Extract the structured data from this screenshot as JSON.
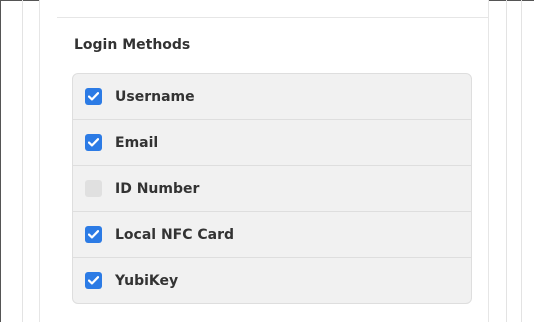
{
  "section": {
    "title": "Login Methods"
  },
  "methods": [
    {
      "label": "Username",
      "checked": true
    },
    {
      "label": "Email",
      "checked": true
    },
    {
      "label": "ID Number",
      "checked": false
    },
    {
      "label": "Local NFC Card",
      "checked": true
    },
    {
      "label": "YubiKey",
      "checked": true
    }
  ],
  "colors": {
    "checkbox_checked": "#2c7be5",
    "checkbox_unchecked": "#e0e0e0",
    "list_background": "#f1f1f1"
  }
}
